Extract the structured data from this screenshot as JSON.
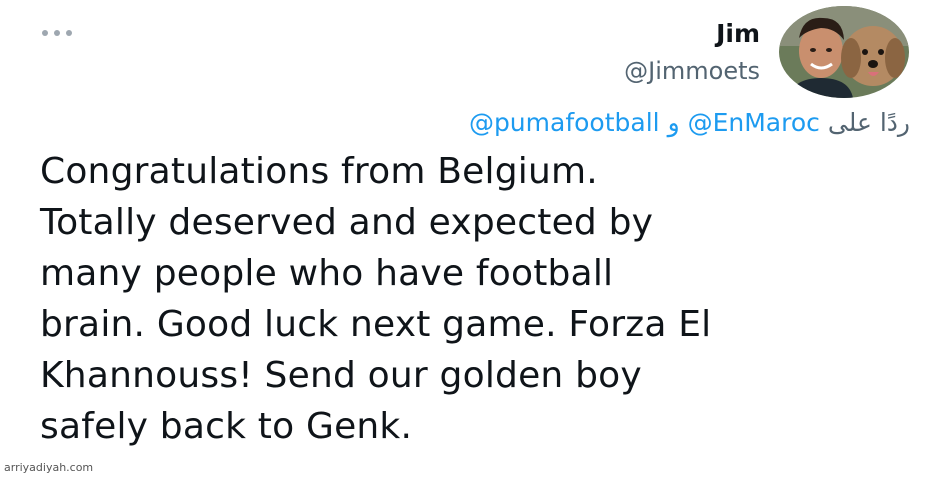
{
  "tweet": {
    "more_icon": "more-horizontal-icon",
    "author": {
      "name": "Jim",
      "handle": "@Jimmoets"
    },
    "reply": {
      "prefix": "ردًا على",
      "mention_1": "@EnMaroc",
      "joiner": "و",
      "mention_2": "@pumafootball"
    },
    "text_lines": [
      "Congratulations from Belgium.",
      "Totally deserved and expected by",
      "many people who have football",
      "brain. Good luck next game. Forza El",
      "Khannouss! Send our golden boy",
      "safely back to Genk."
    ]
  },
  "watermark": "arriyadiyah.com",
  "colors": {
    "link": "#1d9bf0",
    "secondary_text": "#536471",
    "primary_text": "#0f1419"
  }
}
